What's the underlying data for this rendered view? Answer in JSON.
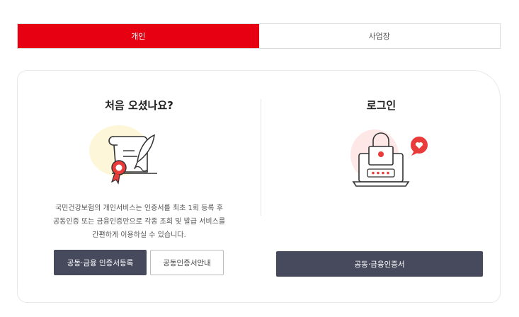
{
  "tabs": [
    {
      "label": "개인",
      "active": true
    },
    {
      "label": "사업장",
      "active": false
    }
  ],
  "first_visit": {
    "title": "처음 오셨나요?",
    "description_lines": [
      "국민건강보험의 개인서비스는 인증서를 최초 1회 등록 후",
      "공동인증 또는 금융인증만으로 각종 조회 및 발급 서비스를",
      "간편하게 이용하실 수 있습니다."
    ],
    "register_button": "공동·금융 인증서등록",
    "guide_button": "공동인증서안내"
  },
  "login": {
    "title": "로그인",
    "button": "공동·금융인증서"
  },
  "colors": {
    "accent": "#e60012",
    "dark_button": "#474a5d"
  },
  "icons": {
    "first_visit": "certificate-scroll-icon",
    "login": "laptop-lock-icon"
  }
}
